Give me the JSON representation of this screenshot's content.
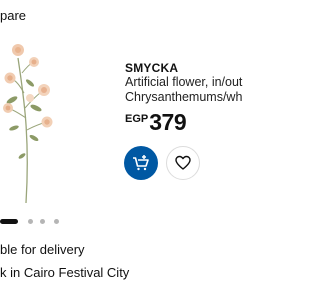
{
  "compare": {
    "label": "pare"
  },
  "product": {
    "name": "SMYCKA",
    "description_line1": "Artificial flower, in/out",
    "description_line2": "Chrysanthemums/wh",
    "currency": "EGP",
    "price": "379",
    "image_icon": "artificial-chrysanthemum-flower-image"
  },
  "actions": {
    "add_to_cart_icon": "cart-add-icon",
    "favourite_icon": "heart-icon",
    "accent_color": "#0058a3"
  },
  "carousel": {
    "total_dots": 4,
    "active_index": 0
  },
  "availability": {
    "delivery": "ble for delivery",
    "store": "k in Cairo Festival City"
  }
}
